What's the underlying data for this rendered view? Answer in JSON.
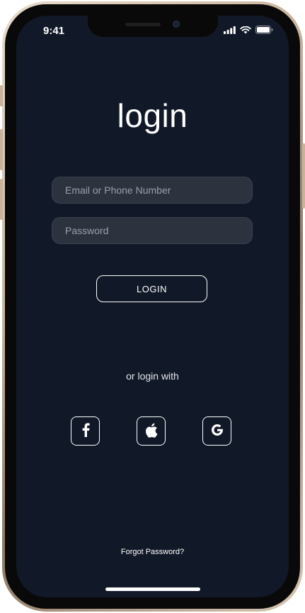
{
  "status_bar": {
    "time": "9:41"
  },
  "login": {
    "title": "login",
    "email_placeholder": "Email or Phone Number",
    "password_placeholder": "Password",
    "login_button": "LOGIN",
    "or_text": "or login with",
    "forgot_password": "Forgot Password?"
  },
  "social": [
    {
      "icon": "facebook-icon"
    },
    {
      "icon": "apple-icon"
    },
    {
      "icon": "google-icon"
    }
  ],
  "colors": {
    "background": "#111827",
    "field_background": "#2c323e",
    "text": "#ffffff"
  }
}
